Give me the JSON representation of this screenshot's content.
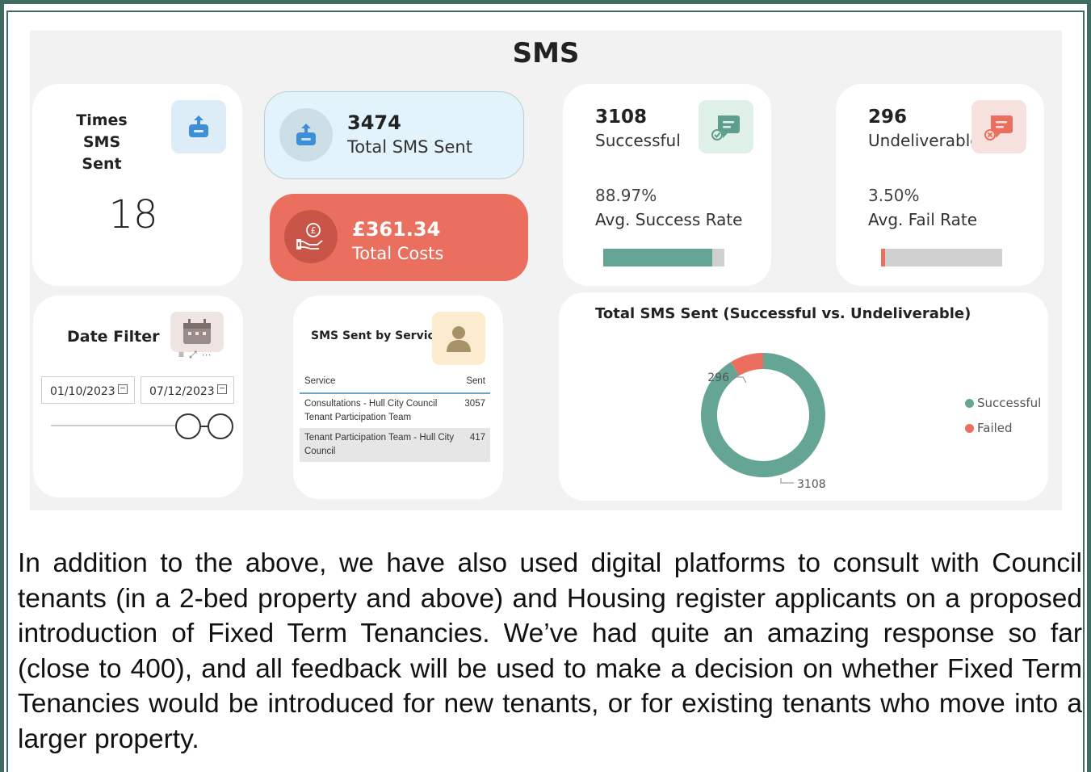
{
  "dashboard": {
    "title": "SMS",
    "times_sms_sent": {
      "label": "Times SMS Sent",
      "value": "18"
    },
    "total_sms_sent": {
      "value": "3474",
      "label": "Total SMS Sent"
    },
    "total_costs": {
      "value": "£361.34",
      "label": "Total Costs"
    },
    "successful": {
      "value": "3108",
      "label": "Successful",
      "rate_value": "88.97%",
      "rate_label": "Avg. Success Rate",
      "bar_fraction": 0.9
    },
    "undeliverable": {
      "value": "296",
      "label": "Undeliverable",
      "rate_value": "3.50%",
      "rate_label": "Avg. Fail Rate",
      "bar_fraction": 0.035
    },
    "date_filter": {
      "label": "Date Filter",
      "start": "01/10/2023",
      "end": "07/12/2023"
    },
    "service_table": {
      "label": "SMS Sent by Service",
      "columns": [
        "Service",
        "Sent"
      ],
      "rows": [
        {
          "service": "Consultations - Hull City Council Tenant Participation Team",
          "sent": "3057"
        },
        {
          "service": "Tenant Participation Team - Hull City Council",
          "sent": "417"
        }
      ]
    },
    "colors": {
      "success": "#64a595",
      "fail": "#ea6f5f",
      "accent_blue": "#4a90d9"
    },
    "icons": [
      "inbox-upload-icon",
      "hand-coin-icon",
      "chat-check-icon",
      "chat-x-icon",
      "calendar-icon",
      "person-icon"
    ]
  },
  "chart_data": {
    "type": "pie",
    "title": "Total SMS Sent (Successful vs. Undeliverable)",
    "categories": [
      "Successful",
      "Failed"
    ],
    "values": [
      3108,
      296
    ],
    "data_labels": [
      "3108",
      "296"
    ],
    "legend": "right"
  },
  "paragraph": "In addition to the above, we have also used digital platforms to consult with Council tenants (in a 2-bed property and above) and Housing register applicants on a proposed introduction of Fixed Term Tenancies. We’ve had quite an amazing response so far (close to 400), and all feedback will be used to make a decision on whether Fixed Term Tenancies would be introduced for new tenants, or for existing tenants who move into a larger property."
}
